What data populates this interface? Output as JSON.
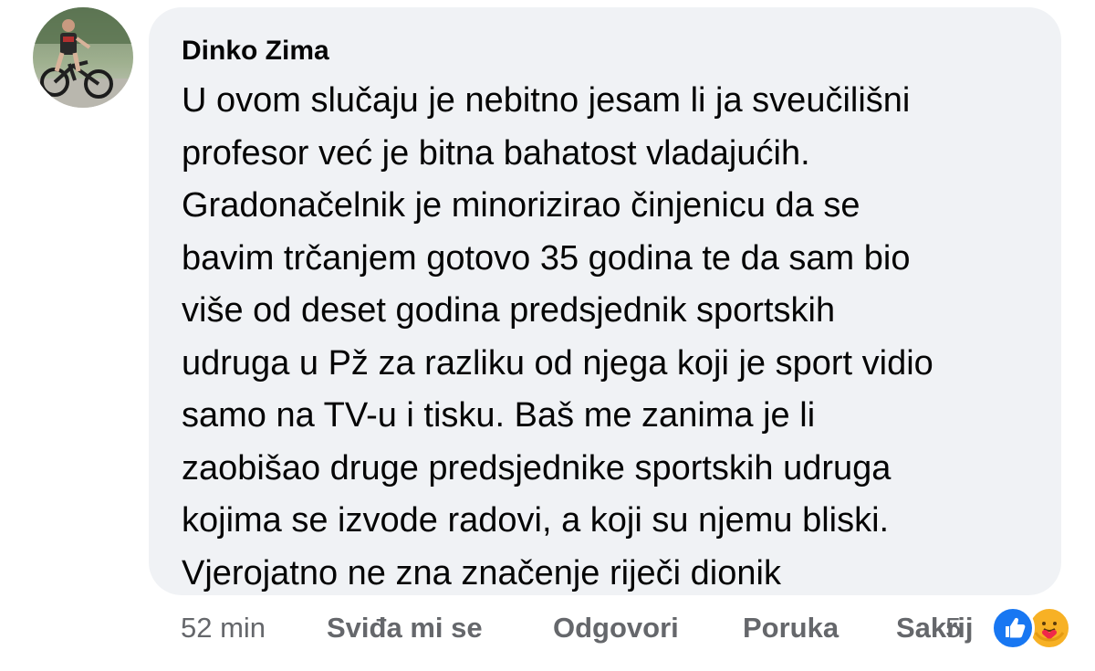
{
  "comment": {
    "author": "Dinko Zima",
    "avatar_icon": "avatar-photo-cyclist",
    "text_lines": [
      "U ovom slučaju je nebitno jesam li ja sveučilišni",
      "profesor već je bitna bahatost vladajućih.",
      "Gradonačelnik je minorizirao činjenicu da se",
      "bavim trčanjem gotovo 35 godina te da sam bio",
      "više od deset godina predsjednik sportskih",
      "udruga u Pž za razliku od njega koji je sport vidio",
      "samo na TV-u i tisku. Baš me zanima je li",
      "zaobišao druge predsjednike sportskih udruga",
      "kojima se izvode radovi, a koji su njemu bliski.",
      "Vjerojatno ne zna značenje riječi dionik"
    ]
  },
  "actions": {
    "time": "52 min",
    "like": "Sviđa mi se",
    "reply": "Odgovori",
    "message": "Poruka",
    "share": "Sakrij"
  },
  "reactions": {
    "count": "5",
    "icons": [
      "like-icon",
      "care-icon"
    ],
    "colors": {
      "like": "#1877f2",
      "care": "#f7b125"
    }
  },
  "colors": {
    "bubble": "#f0f2f5",
    "text": "#050505",
    "secondary": "#65676b"
  }
}
